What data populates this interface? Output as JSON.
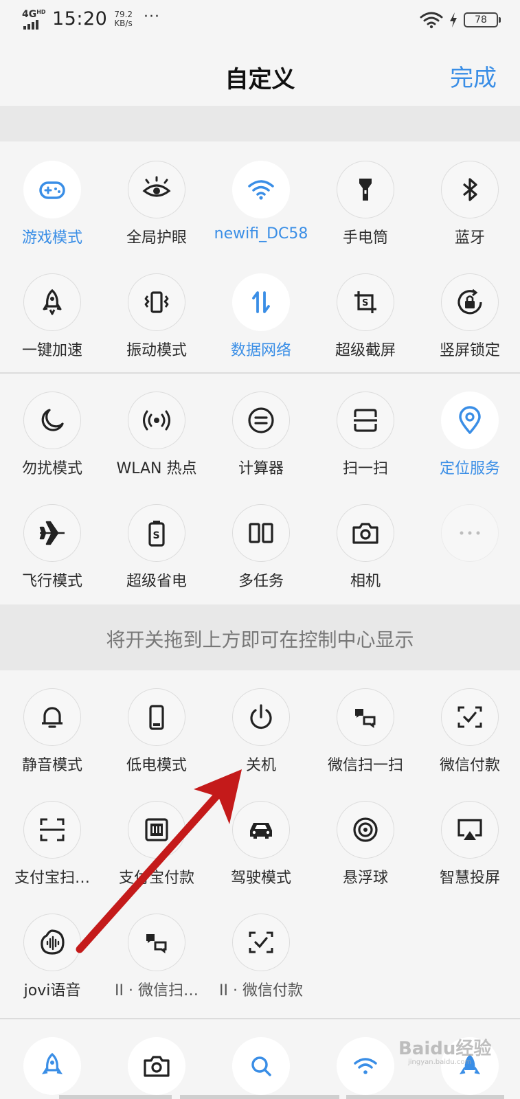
{
  "status_bar": {
    "network": "4G",
    "network_sup": "HD",
    "time": "15:20",
    "speed_value": "79.2",
    "speed_unit": "KB/s",
    "more": "···",
    "battery": "78"
  },
  "header": {
    "title": "自定义",
    "done_label": "完成"
  },
  "colors": {
    "accent": "#3a8ee6",
    "background": "#f5f5f5",
    "band": "#e8e8e8",
    "arrow": "#c41a1a"
  },
  "active_tiles": [
    {
      "label": "游戏模式",
      "icon": "gamepad-icon",
      "active": true
    },
    {
      "label": "全局护眼",
      "icon": "eye-icon",
      "active": false
    },
    {
      "label": "newifi_DC58",
      "icon": "wifi-icon",
      "active": true
    },
    {
      "label": "手电筒",
      "icon": "flashlight-icon",
      "active": false
    },
    {
      "label": "蓝牙",
      "icon": "bluetooth-icon",
      "active": false
    },
    {
      "label": "一键加速",
      "icon": "rocket-icon",
      "active": false
    },
    {
      "label": "振动模式",
      "icon": "vibrate-icon",
      "active": false
    },
    {
      "label": "数据网络",
      "icon": "data-network-icon",
      "active": true
    },
    {
      "label": "超级截屏",
      "icon": "screenshot-icon",
      "active": false
    },
    {
      "label": "竖屏锁定",
      "icon": "rotation-lock-icon",
      "active": false
    },
    {
      "label": "勿扰模式",
      "icon": "moon-icon",
      "active": false
    },
    {
      "label": "WLAN 热点",
      "icon": "hotspot-icon",
      "active": false
    },
    {
      "label": "计算器",
      "icon": "calculator-icon",
      "active": false
    },
    {
      "label": "扫一扫",
      "icon": "scan-icon",
      "active": false
    },
    {
      "label": "定位服务",
      "icon": "location-icon",
      "active": true
    },
    {
      "label": "飞行模式",
      "icon": "airplane-icon",
      "active": false
    },
    {
      "label": "超级省电",
      "icon": "power-saving-icon",
      "active": false
    },
    {
      "label": "多任务",
      "icon": "multitask-icon",
      "active": false
    },
    {
      "label": "相机",
      "icon": "camera-icon",
      "active": false
    },
    {
      "label": "",
      "icon": "more-dots-icon",
      "active": false
    }
  ],
  "hint": "将开关拖到上方即可在控制中心显示",
  "available_tiles": [
    {
      "label": "静音模式",
      "icon": "bell-icon"
    },
    {
      "label": "低电模式",
      "icon": "low-battery-icon"
    },
    {
      "label": "关机",
      "icon": "power-icon"
    },
    {
      "label": "微信扫一扫",
      "icon": "wechat-scan-icon"
    },
    {
      "label": "微信付款",
      "icon": "wechat-pay-icon"
    },
    {
      "label": "支付宝扫…",
      "icon": "alipay-scan-icon"
    },
    {
      "label": "支付宝付款",
      "icon": "alipay-pay-icon"
    },
    {
      "label": "驾驶模式",
      "icon": "car-icon"
    },
    {
      "label": "悬浮球",
      "icon": "floating-ball-icon"
    },
    {
      "label": "智慧投屏",
      "icon": "screen-cast-icon"
    },
    {
      "label": "jovi语音",
      "icon": "jovi-voice-icon"
    },
    {
      "label": "II · 微信扫…",
      "icon": "wechat-scan-icon"
    },
    {
      "label": "II · 微信付款",
      "icon": "wechat-pay-icon"
    }
  ],
  "bottom_bar": [
    {
      "icon": "rocket-icon"
    },
    {
      "icon": "camera-icon"
    },
    {
      "icon": "search-icon"
    },
    {
      "icon": "wifi-icon"
    },
    {
      "icon": "rocket-icon"
    }
  ],
  "watermark": {
    "text": "Baidu经验",
    "sub": "jingyan.baidu.com"
  }
}
